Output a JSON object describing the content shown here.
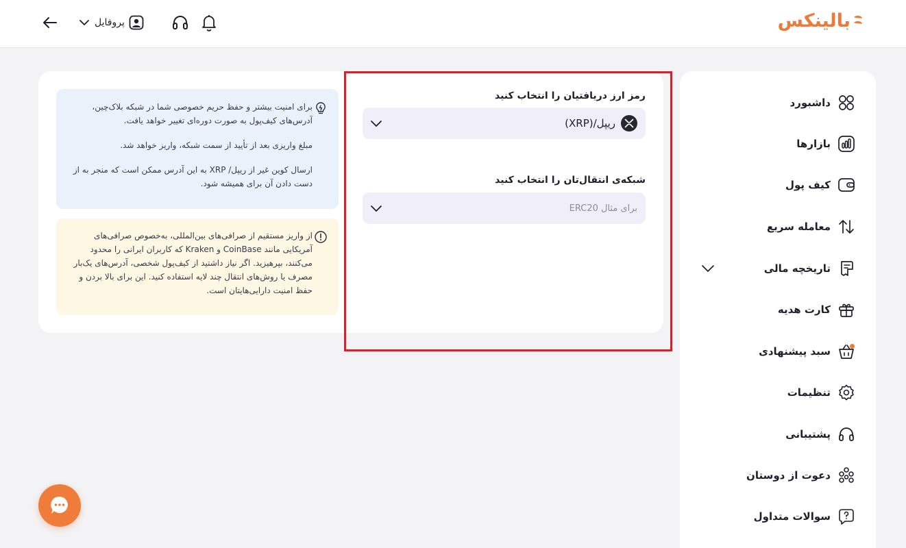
{
  "brand": {
    "logo_text": "بالینکس",
    "accent_color": "#ec7a3a"
  },
  "header": {
    "profile_label": "پروفایل",
    "icons": [
      "back-arrow-icon",
      "chevron-down-icon",
      "user-icon",
      "headset-icon",
      "bell-icon"
    ]
  },
  "sidebar": {
    "items": [
      {
        "label": "داشبورد",
        "icon": "dashboard-icon"
      },
      {
        "label": "بازارها",
        "icon": "chart-icon"
      },
      {
        "label": "کیف پول",
        "icon": "wallet-icon"
      },
      {
        "label": "معامله سریع",
        "icon": "swap-icon"
      },
      {
        "label": "تاریخچه مالی",
        "icon": "receipt-icon"
      },
      {
        "label": "کارت هدیه",
        "icon": "gift-icon"
      },
      {
        "label": "سبد پیشنهادی",
        "icon": "basket-icon"
      },
      {
        "label": "تنظیمات",
        "icon": "gear-icon"
      },
      {
        "label": "پشتیبانی",
        "icon": "headset-icon"
      },
      {
        "label": "دعوت از دوستان",
        "icon": "friends-icon"
      },
      {
        "label": "سوالات متداول",
        "icon": "question-icon"
      }
    ]
  },
  "form": {
    "coin_label": "رمز ارز دریافتیان را انتخاب کنید",
    "coin_value": "ریپل/(XRP)",
    "network_label": "شبکه‌ی انتقال‌تان را انتخاب کنید",
    "network_placeholder": "برای مثال ERC20"
  },
  "info": {
    "paragraphs": [
      "برای امنیت بیشتر و حفظ حریم خصوصی شما در شبکه بلاک‌چین، آدرس‌های کیف‌پول به صورت دوره‌ای تغییر خواهد یافت.",
      "مبلغ واریزی بعد از تأیید از سمت شبکه، واریز خواهد شد.",
      "ارسال کوین غیر از ریپل/ XRP به این آدرس ممکن است که منجر به از دست دادن آن برای همیشه شود."
    ],
    "bg_color": "#e9f2fb"
  },
  "warning": {
    "text": "از واریز مستقیم از صرافی‌های بین‌المللی، به‌خصوص صرافی‌های آمریکایی مانند CoinBase و Kraken که کاربران ایرانی را محدود می‌کنند، بپرهیزید. اگر نیاز داشتید از کیف‌پول شخصی، آدرس‌های یک‌بار مصرف یا روش‌های انتقال چند لایه استفاده کنید. این برای بالا بردن و حفظ امنیت دارایی‌هایتان است.",
    "bg_color": "#fdf7e4"
  },
  "highlight_color": "#d6202b"
}
